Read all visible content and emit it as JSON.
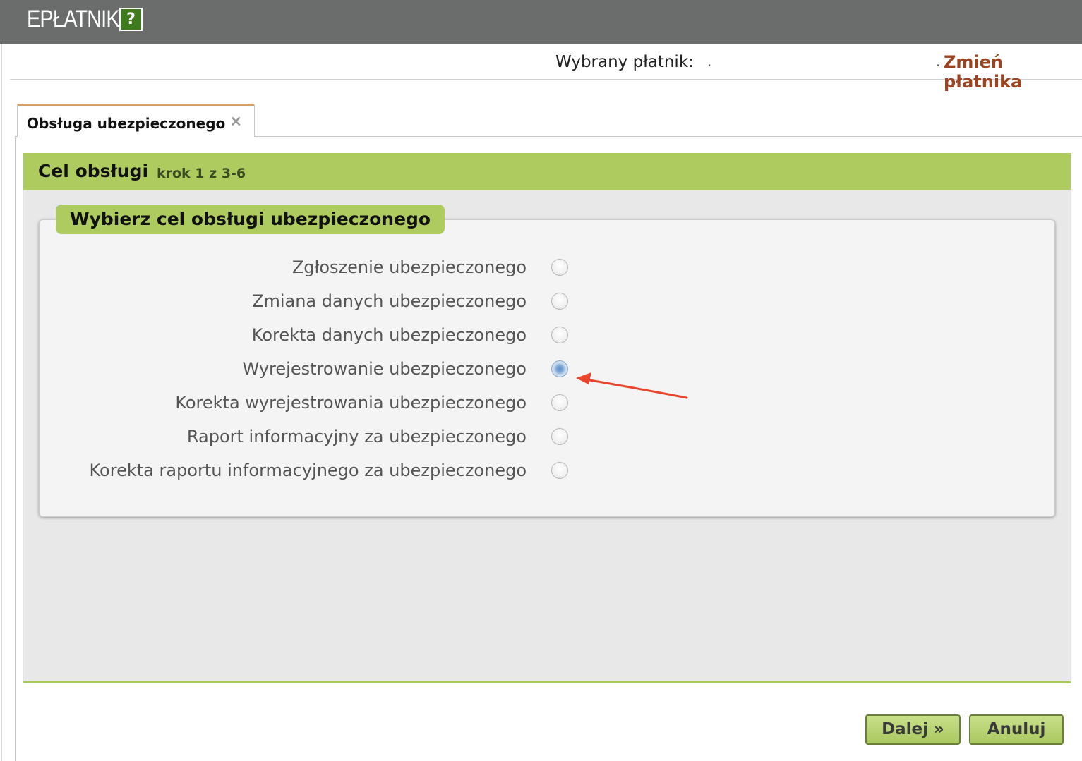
{
  "app": {
    "title": "EPŁATNIK",
    "help_label": "?"
  },
  "payer": {
    "label": "Wybrany płatnik:",
    "value": ".",
    "change_prefix": ".",
    "change_link": "Zmień płatnika"
  },
  "tabs": [
    {
      "label": "Obsługa ubezpieczonego",
      "close": "×"
    }
  ],
  "wizard": {
    "title": "Cel obsługi",
    "step": "krok 1 z 3-6",
    "fieldset_legend": "Wybierz cel obsługi ubezpieczonego",
    "options": [
      {
        "label": "Zgłoszenie ubezpieczonego",
        "checked": false
      },
      {
        "label": "Zmiana danych ubezpieczonego",
        "checked": false
      },
      {
        "label": "Korekta danych ubezpieczonego",
        "checked": false
      },
      {
        "label": "Wyrejestrowanie ubezpieczonego",
        "checked": true
      },
      {
        "label": "Korekta wyrejestrowania ubezpieczonego",
        "checked": false
      },
      {
        "label": "Raport informacyjny za ubezpieczonego",
        "checked": false
      },
      {
        "label": "Korekta raportu informacyjnego za ubezpieczonego",
        "checked": false
      }
    ]
  },
  "buttons": {
    "next": "Dalej »",
    "cancel": "Anuluj"
  },
  "colors": {
    "topbar": "#6b6d6c",
    "accent_green": "#aecb60",
    "link_brown": "#9b4422",
    "arrow_red": "#e8452c"
  },
  "annotation": {
    "arrow_icon": "red-arrow-icon"
  }
}
